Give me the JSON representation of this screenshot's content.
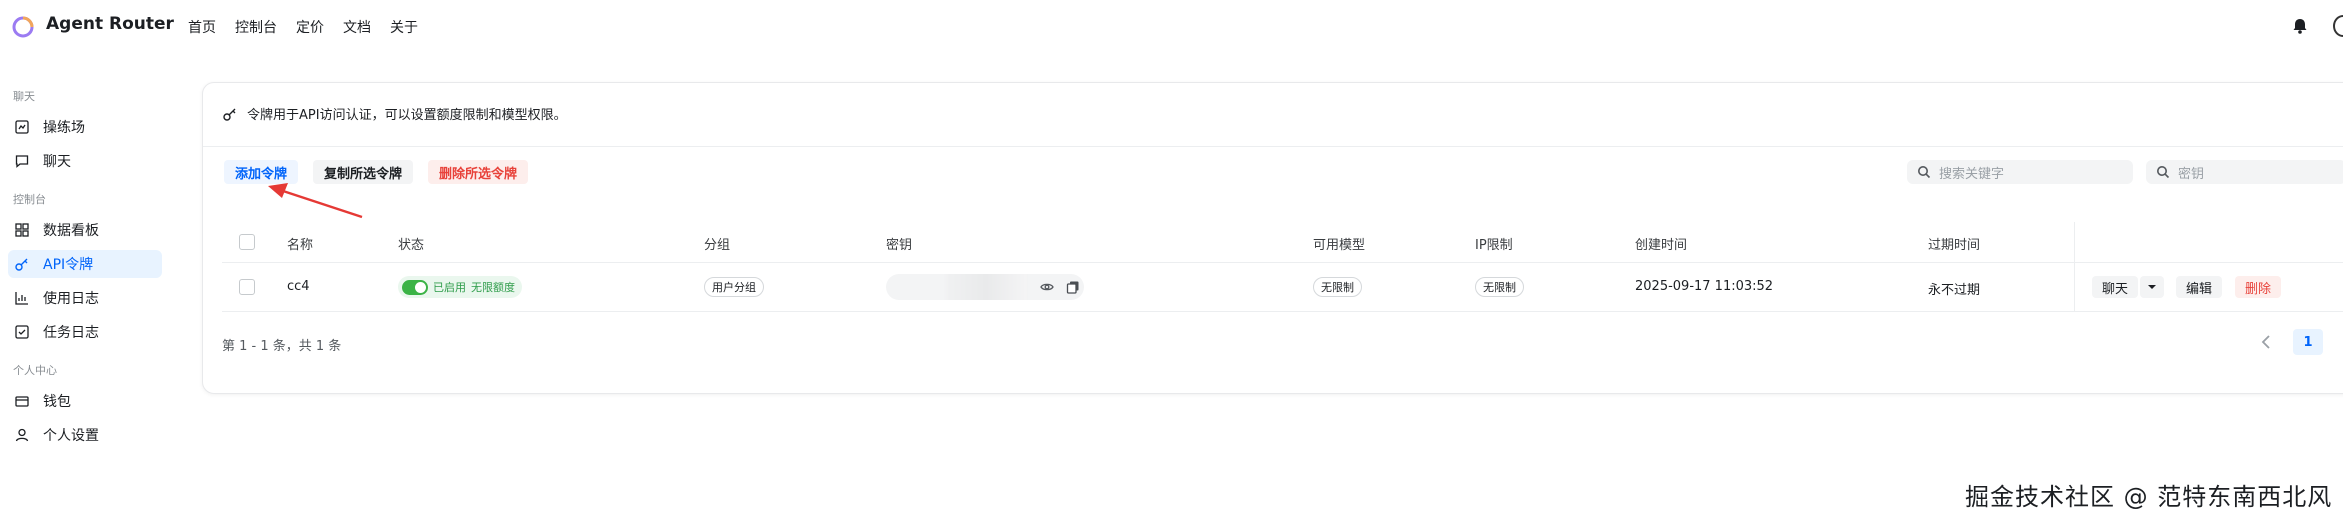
{
  "header": {
    "app_title": "Agent Router",
    "nav": [
      "首页",
      "控制台",
      "定价",
      "文档",
      "关于"
    ]
  },
  "sidebar": {
    "section_chat": "聊天",
    "section_console": "控制台",
    "section_personal": "个人中心",
    "items": [
      {
        "label": "操练场",
        "icon": "playground-icon"
      },
      {
        "label": "聊天",
        "icon": "chat-icon"
      },
      {
        "label": "数据看板",
        "icon": "dashboard-icon"
      },
      {
        "label": "API令牌",
        "icon": "key-icon",
        "active": true
      },
      {
        "label": "使用日志",
        "icon": "bar-chart-icon"
      },
      {
        "label": "任务日志",
        "icon": "task-icon"
      },
      {
        "label": "钱包",
        "icon": "wallet-icon"
      },
      {
        "label": "个人设置",
        "icon": "user-icon"
      }
    ]
  },
  "notice": "令牌用于API访问认证，可以设置额度限制和模型权限。",
  "toolbar": {
    "add": "添加令牌",
    "copy_selected": "复制所选令牌",
    "delete_selected": "删除所选令牌",
    "search_keyword_placeholder": "搜索关键字",
    "search_key_placeholder": "密钥"
  },
  "table": {
    "headers": [
      "名称",
      "状态",
      "分组",
      "密钥",
      "可用模型",
      "IP限制",
      "创建时间",
      "过期时间"
    ],
    "rows": [
      {
        "name": "cc4",
        "status_enabled": "已启用",
        "status_quota": "无限额度",
        "group": "用户分组",
        "models": "无限制",
        "ip_limit": "无限制",
        "created": "2025-09-17 11:03:52",
        "expires": "永不过期",
        "actions": {
          "chat": "聊天",
          "edit": "编辑",
          "delete": "删除"
        }
      }
    ]
  },
  "pagination": {
    "summary": "第 1 - 1 条，共 1 条",
    "current_page": "1"
  },
  "watermark": "掘金技术社区 @ 范特东南西北风",
  "colors": {
    "primary": "#0064fa",
    "danger": "#e8423a",
    "success": "#3bb346",
    "annotation_arrow": "#e53935"
  }
}
